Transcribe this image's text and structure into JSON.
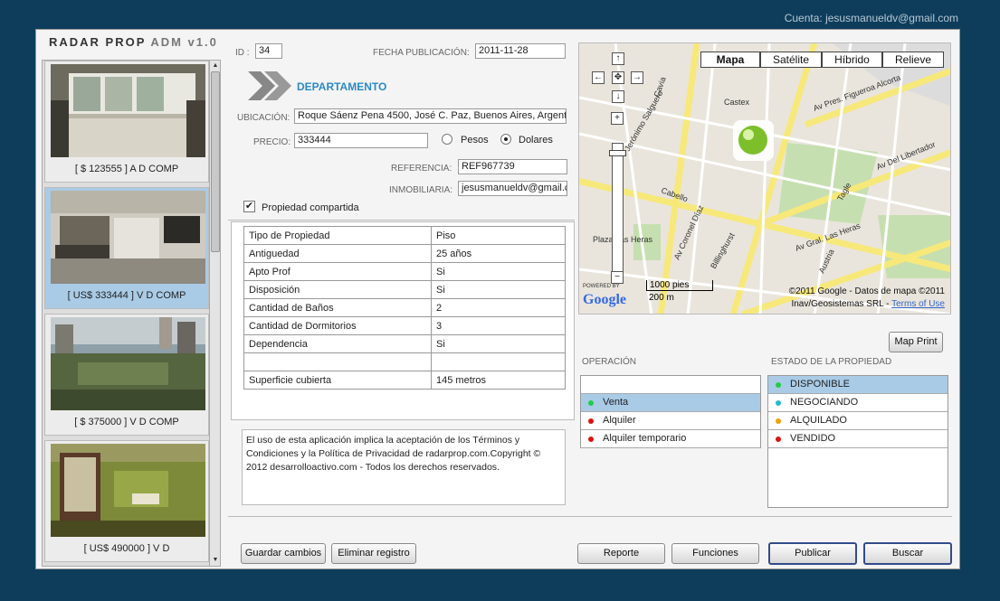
{
  "account": "Cuenta: jesusmanueldv@gmail.com",
  "app": {
    "title_bold": "RADAR PROP",
    "title_rest": "ADM v1.0"
  },
  "listings": [
    {
      "caption": "[ $ 123555 ] A D COMP"
    },
    {
      "caption": "[ US$ 333444 ] V D COMP"
    },
    {
      "caption": "[ $ 375000 ] V D COMP"
    },
    {
      "caption": "[ US$ 490000 ] V D"
    }
  ],
  "form": {
    "id_label": "ID :",
    "id_value": "34",
    "date_label": "FECHA PUBLICACIÓN:",
    "date_value": "2011-11-28",
    "type": "DEPARTAMENTO",
    "location_label": "UBICACIÓN:",
    "location_value": "Roque Sáenz Pena 4500, José C. Paz, Buenos Aires, Argent",
    "price_label": "PRECIO:",
    "price_value": "333444",
    "currency_pesos": "Pesos",
    "currency_dolares": "Dolares",
    "reference_label": "REFERENCIA:",
    "reference_value": "REF967739",
    "agency_label": "INMOBILIARIA:",
    "agency_value": "jesusmanueldv@gmail.c",
    "shared_label": "Propiedad compartida"
  },
  "attributes": [
    [
      "Tipo de Propiedad",
      "Piso"
    ],
    [
      "Antiguedad",
      "25 años"
    ],
    [
      "Apto Prof",
      "Si"
    ],
    [
      "Disposición",
      "Si"
    ],
    [
      "Cantidad de Baños",
      "2"
    ],
    [
      "Cantidad de Dormitorios",
      "3"
    ],
    [
      "Dependencia",
      "Si"
    ],
    [
      "",
      ""
    ],
    [
      "Superficie cubierta",
      "145 metros"
    ]
  ],
  "legal": "El uso de esta aplicación implica la aceptación de los Términos y Condiciones y la Política de Privacidad de radarprop.com.Copyright © 2012 desarrolloactivo.com - Todos los derechos reservados.",
  "map": {
    "types": [
      "Mapa",
      "Satélite",
      "Híbrido",
      "Relieve"
    ],
    "scale_ft": "1000 pies",
    "scale_m": "200 m",
    "powered": "POWERED BY",
    "google": "Google",
    "copyright": "©2011 Google - Datos de mapa ©2011",
    "copyright2": "Inav/Geosistemas SRL -",
    "terms": "Terms of Use",
    "print": "Map Print"
  },
  "streets": [
    "Av Del Libertador",
    "Av Pres. Figueroa Alcorta",
    "Av Gral. Las Heras",
    "Jerónimo Salguero",
    "Av Coronel Díaz",
    "Cabello",
    "Austria",
    "Billinghurst",
    "Tagle",
    "Castex",
    "Cavia",
    "Plaza Las Heras"
  ],
  "operations": {
    "label": "OPERACIÓN",
    "items": [
      {
        "label": "",
        "color": ""
      },
      {
        "label": "Venta",
        "color": "#22cc44"
      },
      {
        "label": "Alquiler",
        "color": "#dd1111"
      },
      {
        "label": "Alquiler temporario",
        "color": "#dd1111"
      }
    ]
  },
  "states": {
    "label": "ESTADO DE LA PROPIEDAD",
    "items": [
      {
        "label": "DISPONIBLE",
        "color": "#22cc44"
      },
      {
        "label": "NEGOCIANDO",
        "color": "#22bbcc"
      },
      {
        "label": "ALQUILADO",
        "color": "#f0a000"
      },
      {
        "label": "VENDIDO",
        "color": "#dd1111"
      }
    ]
  },
  "buttons": {
    "save": "Guardar cambios",
    "delete": "Eliminar registro",
    "report": "Reporte",
    "functions": "Funciones",
    "publish": "Publicar",
    "search": "Buscar"
  }
}
